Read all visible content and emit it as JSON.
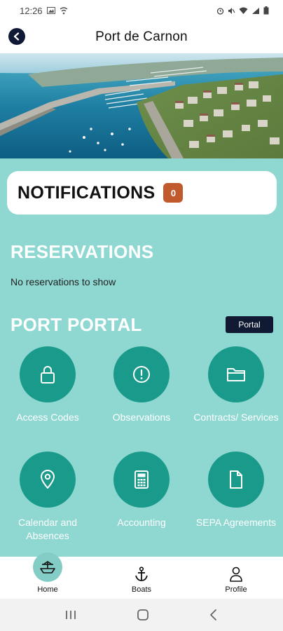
{
  "status_bar": {
    "time": "12:26"
  },
  "header": {
    "title": "Port de Carnon"
  },
  "notifications": {
    "title": "NOTIFICATIONS",
    "count": "0"
  },
  "reservations": {
    "title": "RESERVATIONS",
    "empty_text": "No reservations to show"
  },
  "portal": {
    "title": "PORT PORTAL",
    "button_label": "Portal",
    "tiles": [
      {
        "label": "Access Codes",
        "icon": "lock-icon"
      },
      {
        "label": "Observations",
        "icon": "alert-circle-icon"
      },
      {
        "label": "Contracts/ Services",
        "icon": "folder-icon"
      },
      {
        "label": "Calendar and Absences",
        "icon": "map-pin-icon"
      },
      {
        "label": "Accounting",
        "icon": "calculator-icon"
      },
      {
        "label": "SEPA Agreements",
        "icon": "document-icon"
      }
    ]
  },
  "bottom_nav": {
    "items": [
      {
        "label": "Home",
        "icon": "boat-home-icon"
      },
      {
        "label": "Boats",
        "icon": "anchor-icon"
      },
      {
        "label": "Profile",
        "icon": "user-icon"
      }
    ],
    "active": "Home"
  },
  "colors": {
    "teal_background": "#8ed8d1",
    "tile_circle": "#1a9a8b",
    "badge": "#c0592c",
    "portal_button": "#111a33",
    "back_button": "#101936"
  }
}
